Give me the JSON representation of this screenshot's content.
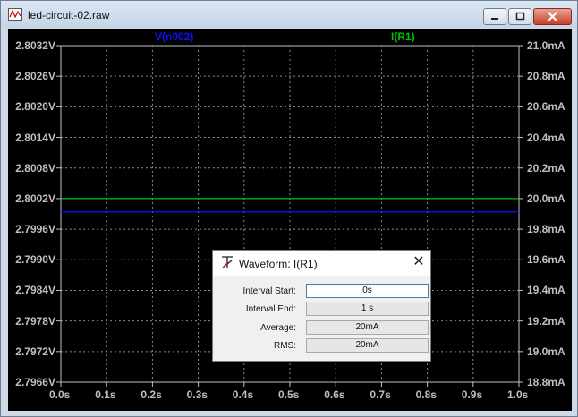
{
  "window": {
    "title": "led-circuit-02.raw"
  },
  "plot": {
    "left_trace": {
      "name": "V(n002)",
      "color": "#1010ff"
    },
    "right_trace": {
      "name": "I(R1)",
      "color": "#00c000"
    },
    "left_axis_ticks": [
      "2.8032V",
      "2.8026V",
      "2.8020V",
      "2.8014V",
      "2.8008V",
      "2.8002V",
      "2.7996V",
      "2.7990V",
      "2.7984V",
      "2.7978V",
      "2.7972V",
      "2.7966V"
    ],
    "right_axis_ticks": [
      "21.0mA",
      "20.8mA",
      "20.6mA",
      "20.4mA",
      "20.2mA",
      "20.0mA",
      "19.8mA",
      "19.6mA",
      "19.4mA",
      "19.2mA",
      "19.0mA",
      "18.8mA"
    ],
    "x_axis_ticks": [
      "0.0s",
      "0.1s",
      "0.2s",
      "0.3s",
      "0.4s",
      "0.5s",
      "0.6s",
      "0.7s",
      "0.8s",
      "0.9s",
      "1.0s"
    ]
  },
  "chart_data": {
    "type": "line",
    "x": [
      0,
      1
    ],
    "xlim": [
      0,
      1
    ],
    "ylim_left": [
      2.7966,
      2.8032
    ],
    "ylim_right": [
      18.8,
      21.0
    ],
    "series": [
      {
        "name": "V(n002)",
        "axis": "left",
        "unit": "V",
        "values": [
          2.79994,
          2.79994
        ],
        "color": "#1010ff"
      },
      {
        "name": "I(R1)",
        "axis": "right",
        "unit": "mA",
        "values": [
          20.0,
          20.0
        ],
        "color": "#00c000"
      }
    ],
    "grid": true
  },
  "dialog": {
    "title": "Waveform: I(R1)",
    "rows": [
      {
        "label": "Interval Start:",
        "value": "0s"
      },
      {
        "label": "Interval End:",
        "value": "1 s"
      },
      {
        "label": "Average:",
        "value": "20mA"
      },
      {
        "label": "RMS:",
        "value": "20mA"
      }
    ]
  }
}
